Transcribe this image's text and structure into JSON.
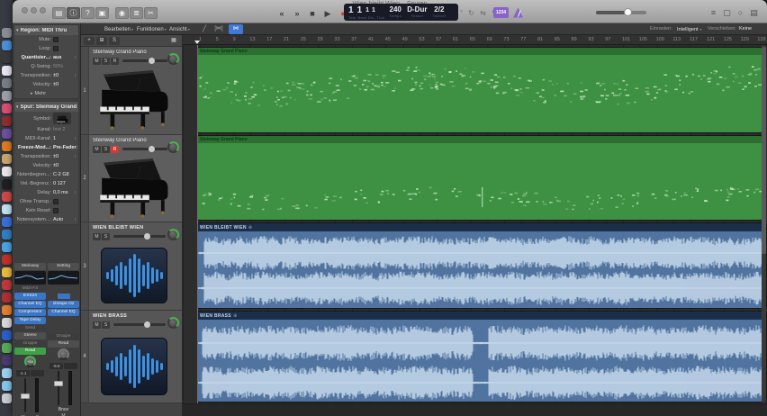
{
  "window": {
    "title": "Wien bleibt Wien – Spuren"
  },
  "dock": {
    "icon_colors": [
      "#8a8f96",
      "#4a90d9",
      "#3a3a3c",
      "#e8e4f0",
      "#7a7d82",
      "#9aa0a6",
      "#d94f70",
      "#8c2f2f",
      "#6b4fa0",
      "#e07820",
      "#c8a46a",
      "#e8e8e8",
      "#1f1f21",
      "#d04848",
      "#bfe0f2",
      "#3a6fd8",
      "#2f80c4",
      "#4aa3e0",
      "#c03028",
      "#e8b93a",
      "#c23838",
      "#b03030",
      "#e08030",
      "#d8d8d8",
      "#2860c8",
      "#58a858",
      "#4a3a70",
      "#9ad0f0",
      "#86c4ec",
      "#c8ccd2"
    ]
  },
  "control_bar": {
    "view_buttons": [
      {
        "name": "library-button",
        "glyph": "▤"
      },
      {
        "name": "inspector-button",
        "glyph": "ⓘ"
      },
      {
        "name": "quick-help-button",
        "glyph": "?"
      },
      {
        "name": "toolbar-button",
        "glyph": "▣"
      }
    ],
    "panel_buttons": [
      {
        "name": "smart-controls-button",
        "glyph": "◉"
      },
      {
        "name": "mixer-button",
        "glyph": "≣"
      },
      {
        "name": "editors-button",
        "glyph": "✂"
      }
    ],
    "transport": {
      "rewind": "«",
      "forward": "»",
      "stop": "■",
      "play": "▶",
      "record": "●"
    },
    "lcd": {
      "bar": "1",
      "beat": "1",
      "div": "1",
      "tick": "1",
      "position_labels": "Takt Beat Div. Tick",
      "tempo": "240",
      "tempo_label": "Tempo",
      "key": "D-Dur",
      "key_label": "Tonart",
      "timesig": "2/2",
      "timesig_label": "Taktart"
    },
    "mode_buttons": [
      {
        "name": "cycle-button",
        "glyph": "↻"
      },
      {
        "name": "autopunch-button",
        "glyph": "⇆"
      },
      {
        "name": "replace-button",
        "glyph": "✎"
      },
      {
        "name": "low-latency-button",
        "glyph": "Ⓛ"
      }
    ],
    "count_in_label": "1234",
    "right_buttons": [
      {
        "name": "list-editors-button",
        "glyph": "≡"
      },
      {
        "name": "note-pads-button",
        "glyph": "▢"
      },
      {
        "name": "apple-loops-button",
        "glyph": "○"
      },
      {
        "name": "browsers-button",
        "glyph": "▤"
      }
    ]
  },
  "inspector": {
    "region_section": {
      "title": "Region: MIDI Thru",
      "rows": [
        {
          "label": "Mute:",
          "type": "check"
        },
        {
          "label": "Loop:",
          "type": "check"
        },
        {
          "label": "Quantisier...:",
          "value": "aus",
          "type": "stepper",
          "bold": true
        },
        {
          "label": "Q-Swing:",
          "value": "50%",
          "dim": true
        },
        {
          "label": "Transposition:",
          "value": "±0",
          "type": "stepper"
        },
        {
          "label": "Velocity:",
          "value": "±0"
        },
        {
          "label": "Mehr",
          "type": "disclosure"
        }
      ]
    },
    "track_section": {
      "title": "Spur: Steinway Grand Piano",
      "rows": [
        {
          "label": "Symbol:",
          "type": "symbol"
        },
        {
          "label": "Kanal:",
          "value": "Inst 2",
          "dim": true
        },
        {
          "label": "MIDI-Kanal:",
          "value": "1",
          "type": "stepper"
        },
        {
          "label": "Freeze-Mod...:",
          "value": "Pre-Fader",
          "type": "stepper",
          "bold": true
        },
        {
          "label": "Transposition:",
          "value": "±0",
          "type": "stepper"
        },
        {
          "label": "Velocity:",
          "value": "±0"
        },
        {
          "label": "Notenbegren...:",
          "value": "C-2  G8"
        },
        {
          "label": "Vel.-Begrenz.:",
          "value": "0  127"
        },
        {
          "label": "Delay:",
          "value": "0,0 ms",
          "type": "stepper"
        },
        {
          "label": "Ohne Transp.:",
          "type": "check"
        },
        {
          "label": "Kein Reset:",
          "type": "check"
        },
        {
          "label": "Notensystem...:",
          "value": "Auto",
          "type": "stepper"
        }
      ]
    }
  },
  "strips": {
    "left": {
      "setting": "Steinway",
      "midi_fx": "MIDI-FX",
      "slots": [
        "EXS24",
        "Channel EQ",
        "Compressor",
        "Tape Delay"
      ],
      "send": "Send",
      "output": "Stereo",
      "group": "Gruppe",
      "automation": "Read",
      "pan": "+16",
      "vol": "-1.1",
      "mute": "M",
      "solo": "S"
    },
    "right": {
      "setting": "Setting",
      "slots": [
        "iZotope Oz",
        "Channel EQ"
      ],
      "group": "Gruppe",
      "automation": "Read",
      "vol": "-9.0",
      "name": "Bnce",
      "mute": "M"
    }
  },
  "track_area": {
    "menus": [
      "Bearbeiten",
      "Funktionen",
      "Ansicht"
    ],
    "add_track": "+",
    "dup_track": "⊞",
    "global_s": "S",
    "header_config": "▦",
    "tracks": [
      {
        "num": "1",
        "name": "Steinway Grand Piano",
        "mute": "M",
        "solo": "S",
        "rec": "R"
      },
      {
        "num": "2",
        "name": "Steinway Grand Piano",
        "mute": "M",
        "solo": "S",
        "rec": "R"
      },
      {
        "num": "3",
        "name": "WIEN BLEIBT WIEN",
        "mute": "M",
        "solo": "S"
      },
      {
        "num": "4",
        "name": "WIEN BRASS",
        "mute": "M",
        "solo": "S"
      }
    ]
  },
  "arrange": {
    "tools": {
      "automation": "╱",
      "flex": "[⋈]",
      "catch": "⋈"
    },
    "snap_label": "Einrasten:",
    "snap_value": "Intelligent",
    "drag_label": "Verschieben:",
    "drag_value": "Keine Überlappung",
    "zoom_v": "↕",
    "zoom_h": "↔",
    "ruler_ticks": [
      1,
      5,
      9,
      13,
      17,
      21,
      25,
      29,
      33,
      37,
      41,
      45,
      49,
      53,
      57,
      61,
      65,
      69,
      73,
      77,
      81,
      85,
      89,
      93,
      97,
      101,
      105,
      109,
      113,
      117,
      121,
      125,
      129,
      133
    ],
    "regions": [
      {
        "name": "Steinway Grand Piano"
      },
      {
        "name": "Steinway Grand Piano"
      },
      {
        "name": "WIEN BLEIBT WIEN",
        "badge": "⊕"
      },
      {
        "name": "WIEN BRASS",
        "badge": "⊕"
      }
    ]
  },
  "colors": {
    "accent_purple": "#8a63c6",
    "record_red": "#d23b2f",
    "midi_region_green": "#3e9142",
    "midi_region_header_green": "#2c7031",
    "audio_region_blue": "#50749f",
    "audio_region_header_navy": "#1c2f49",
    "waveform_light_blue": "#c6d9ec",
    "plugin_slot_blue": "#3a76c4",
    "read_automation_green": "#3fa046",
    "selection_blue": "#3f7ad6"
  }
}
